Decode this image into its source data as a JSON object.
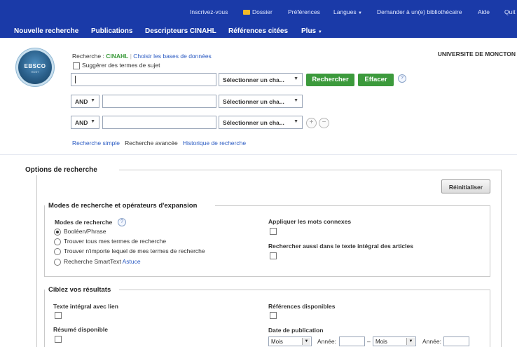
{
  "toolbar": {
    "sign_in": "Inscrivez-vous",
    "folder": "Dossier",
    "preferences": "Préférences",
    "languages": "Langues",
    "ask_librarian": "Demander à un(e) bibliothécaire",
    "help": "Aide",
    "quit": "Quit"
  },
  "nav": {
    "new_search": "Nouvelle recherche",
    "publications": "Publications",
    "cinahl_headings": "Descripteurs CINAHL",
    "cited_refs": "Références citées",
    "more": "Plus"
  },
  "logo": {
    "text": "EBSCO",
    "sub": "HOST"
  },
  "search": {
    "searching_label": "Recherche :",
    "database": "CINAHL",
    "choose_db": "Choisir les bases de données",
    "suggest_terms": "Suggérer des termes de sujet",
    "field_select": "Sélectionner un cha...",
    "search_button": "Rechercher",
    "clear_button": "Effacer",
    "op1": "AND",
    "op2": "AND",
    "simple": "Recherche simple",
    "advanced": "Recherche avancée",
    "history": "Historique de recherche",
    "institution": "UNIVERSITE DE MONCTON"
  },
  "options": {
    "title": "Options de recherche",
    "reset": "Réinitialiser",
    "modes_section": "Modes de recherche et opérateurs d'expansion",
    "modes_label": "Modes de recherche",
    "mode_boolean": "Booléen/Phrase",
    "mode_all": "Trouver tous mes termes de recherche",
    "mode_any": "Trouver n'importe lequel de mes termes de recherche",
    "mode_smarttext": "Recherche SmartText",
    "tip": "Astuce",
    "related_words": "Appliquer les mots connexes",
    "fulltext_search": "Rechercher aussi dans le texte intégral des articles",
    "limit_section": "Ciblez vos résultats",
    "linked_fulltext": "Texte intégral avec lien",
    "refs_available": "Références disponibles",
    "abstract_available": "Résumé disponible",
    "pub_date": "Date de publication",
    "month": "Mois",
    "year": "Année:",
    "dash": "–"
  }
}
